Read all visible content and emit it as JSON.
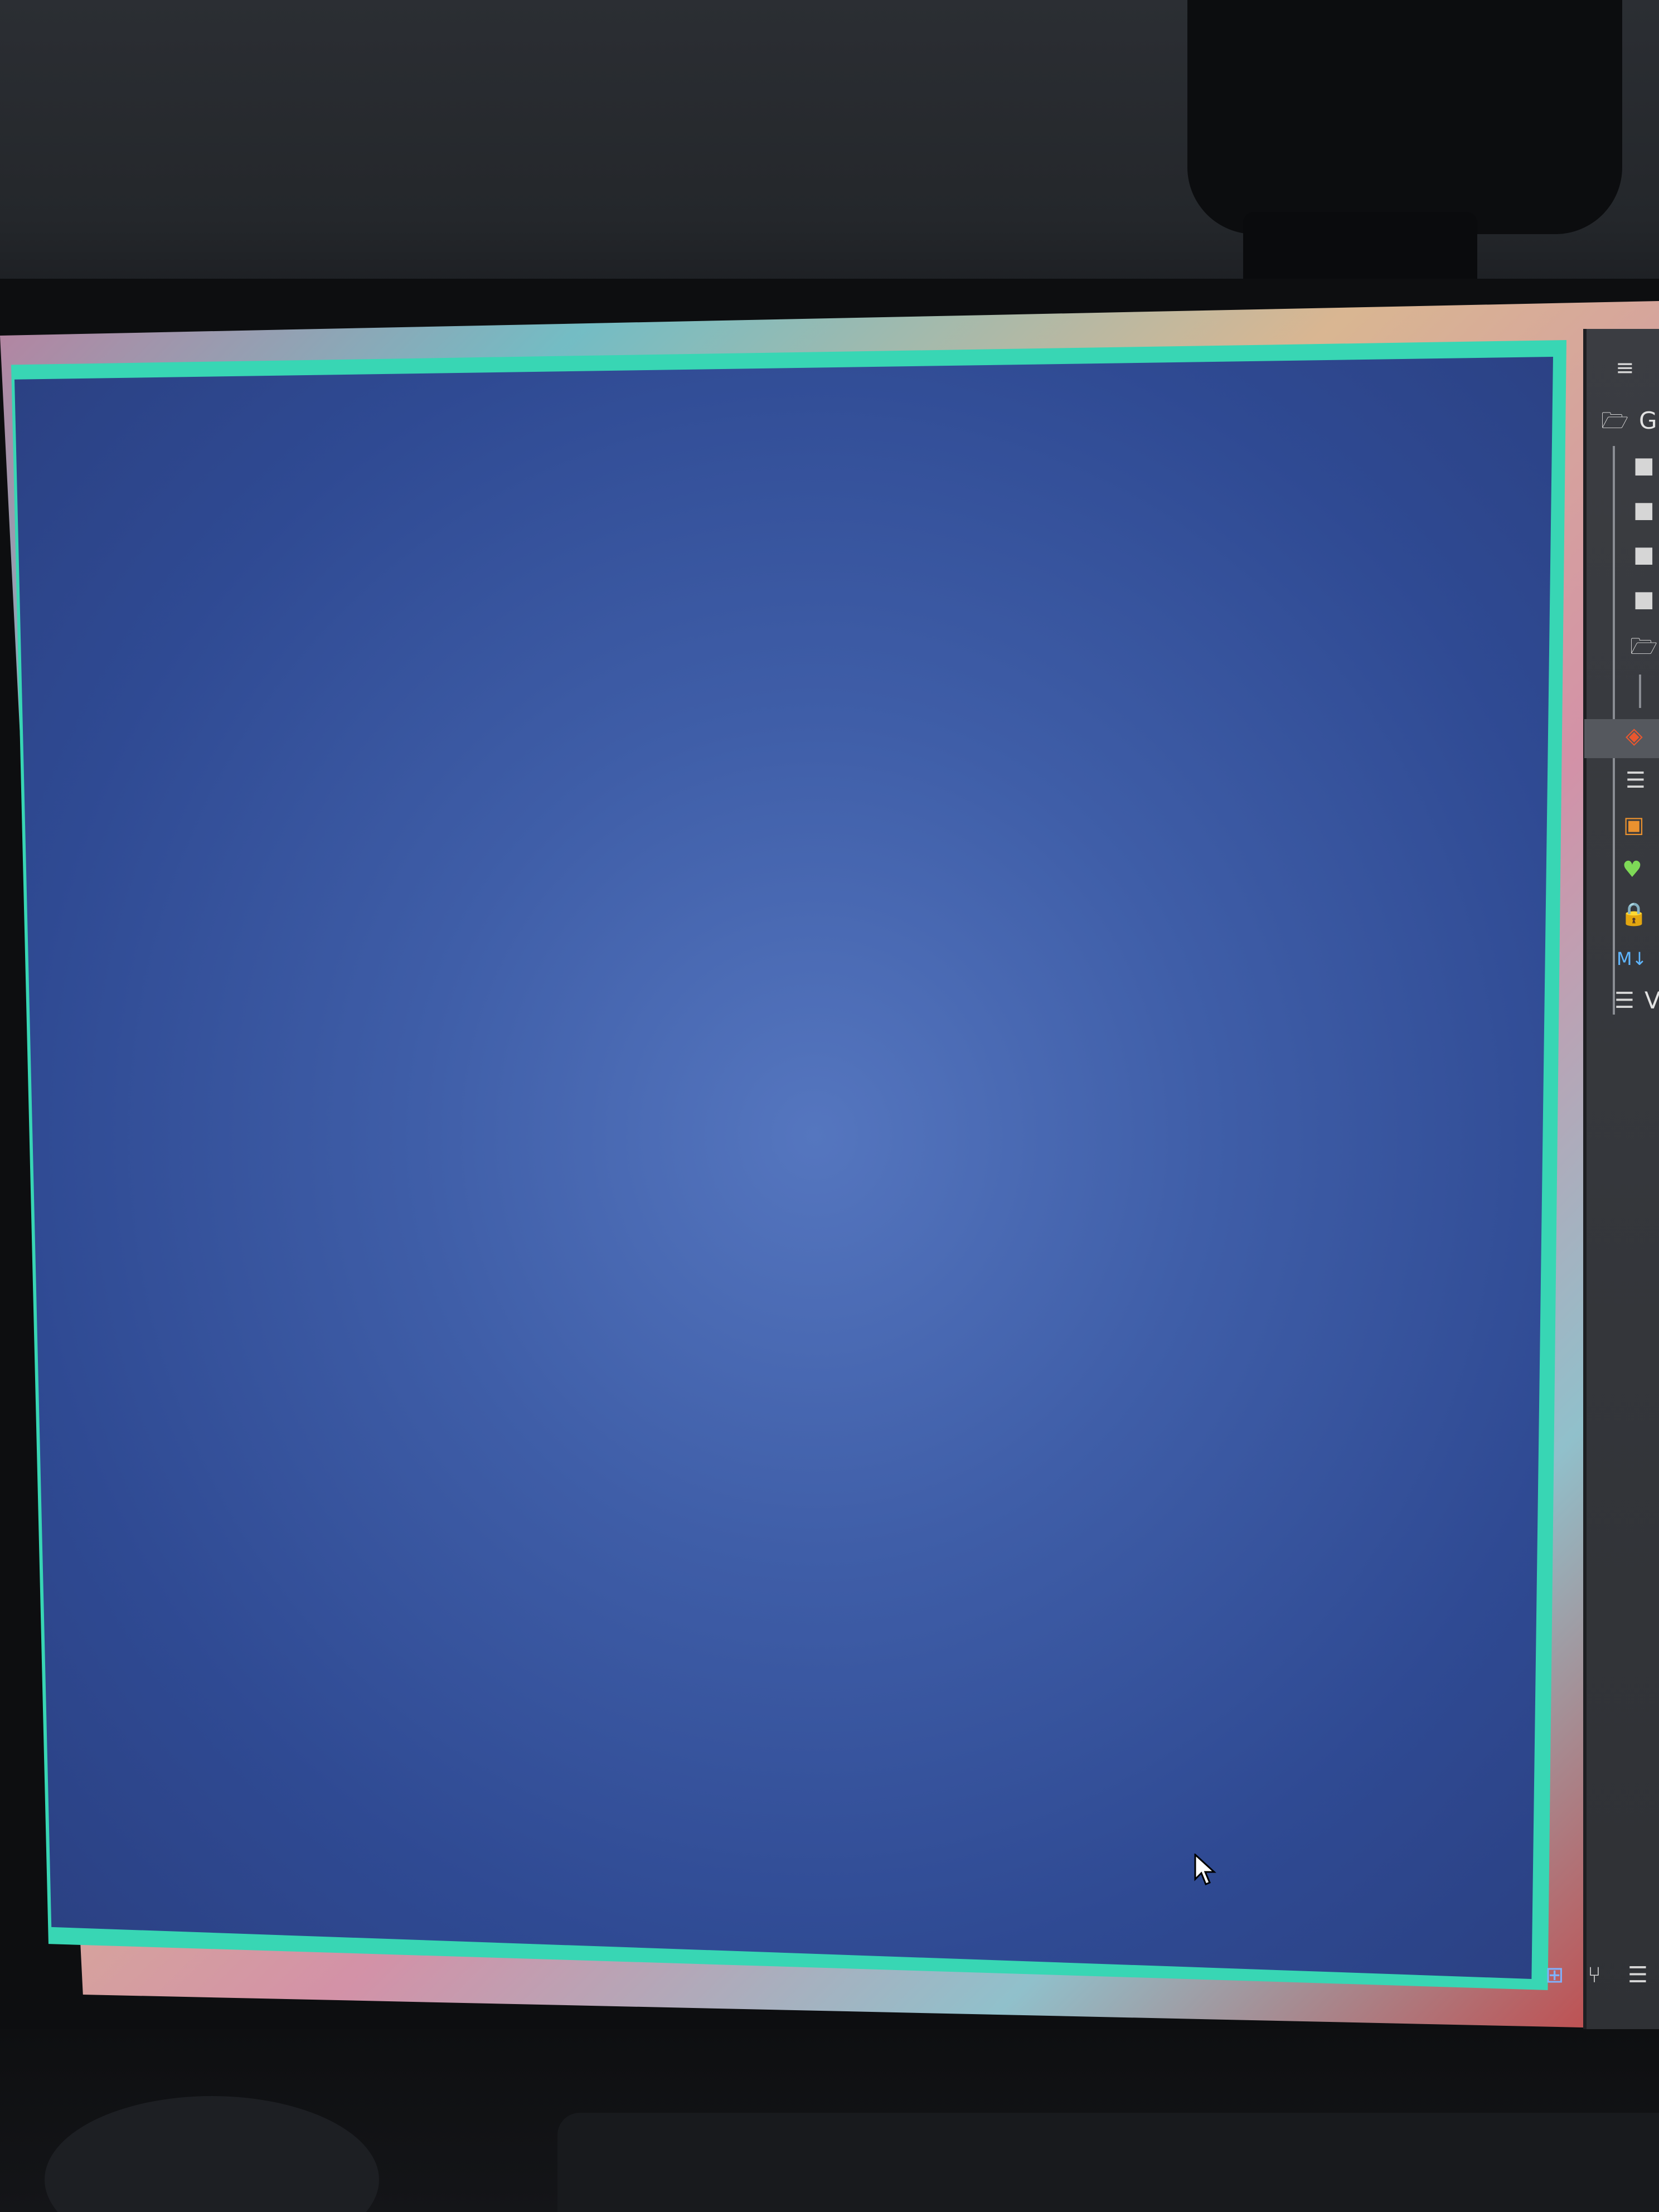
{
  "side_panel": {
    "header_icon": "hamburger-menu-icon",
    "root_label": "Gi",
    "items": [
      {
        "icon": "folder-icon",
        "color": "#d6d6d6"
      },
      {
        "icon": "folder-icon",
        "color": "#d6d6d6"
      },
      {
        "icon": "folder-icon",
        "color": "#d6d6d6"
      },
      {
        "icon": "folder-icon",
        "color": "#d6d6d6"
      },
      {
        "icon": "open-folder-icon",
        "color": "#d6d6d6"
      },
      {
        "icon": "git-icon",
        "color": "#e9572f"
      },
      {
        "icon": "text-file-icon",
        "color": "#d6d6d6"
      },
      {
        "icon": "presentation-file-icon",
        "color": "#e9912f"
      },
      {
        "icon": "heart-icon",
        "color": "#7ed957"
      },
      {
        "icon": "lock-file-icon",
        "color": "#f0c93a"
      },
      {
        "icon": "markdown-file-icon",
        "color": "#5fb6ff"
      },
      {
        "icon": "text-file-icon",
        "color": "#d6d6d6"
      }
    ],
    "last_label": "V",
    "bottom_toolbar": [
      "tree-view-icon",
      "git-branch-icon",
      "list-view-icon"
    ]
  },
  "colors": {
    "window_border": "#38d6b4",
    "window_fill": "#3f5ea8"
  }
}
